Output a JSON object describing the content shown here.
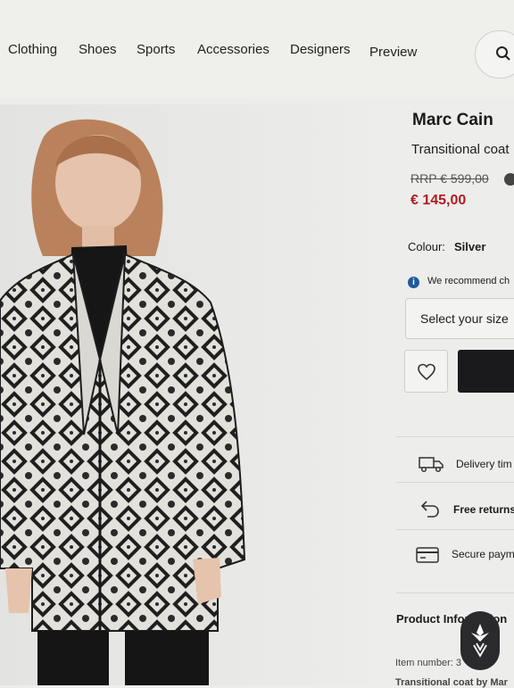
{
  "nav": {
    "items": [
      "Clothing",
      "Shoes",
      "Sports",
      "Accessories",
      "Designers",
      "Preview"
    ]
  },
  "search": {
    "icon": "search-icon"
  },
  "product": {
    "brand": "Marc Cain",
    "name": "Transitional coat",
    "rrp": "RRP € 599,00",
    "price": "€ 145,00",
    "colour_label": "Colour:",
    "colour_value": "Silver",
    "recommend_text": "We recommend ch",
    "size_placeholder": "Select your size"
  },
  "usps": [
    {
      "icon": "delivery-truck-icon",
      "text": "Delivery tim"
    },
    {
      "icon": "return-arrow-icon",
      "text": "Free returns"
    },
    {
      "icon": "credit-card-icon",
      "text": "Secure paym"
    }
  ],
  "details": {
    "title": "Product Information",
    "item_number": "Item number: 3",
    "bottom_text": "Transitional coat by Mar"
  },
  "colors": {
    "price": "#b01c22",
    "info": "#1e5a9c",
    "button": "#1a1a1c"
  }
}
